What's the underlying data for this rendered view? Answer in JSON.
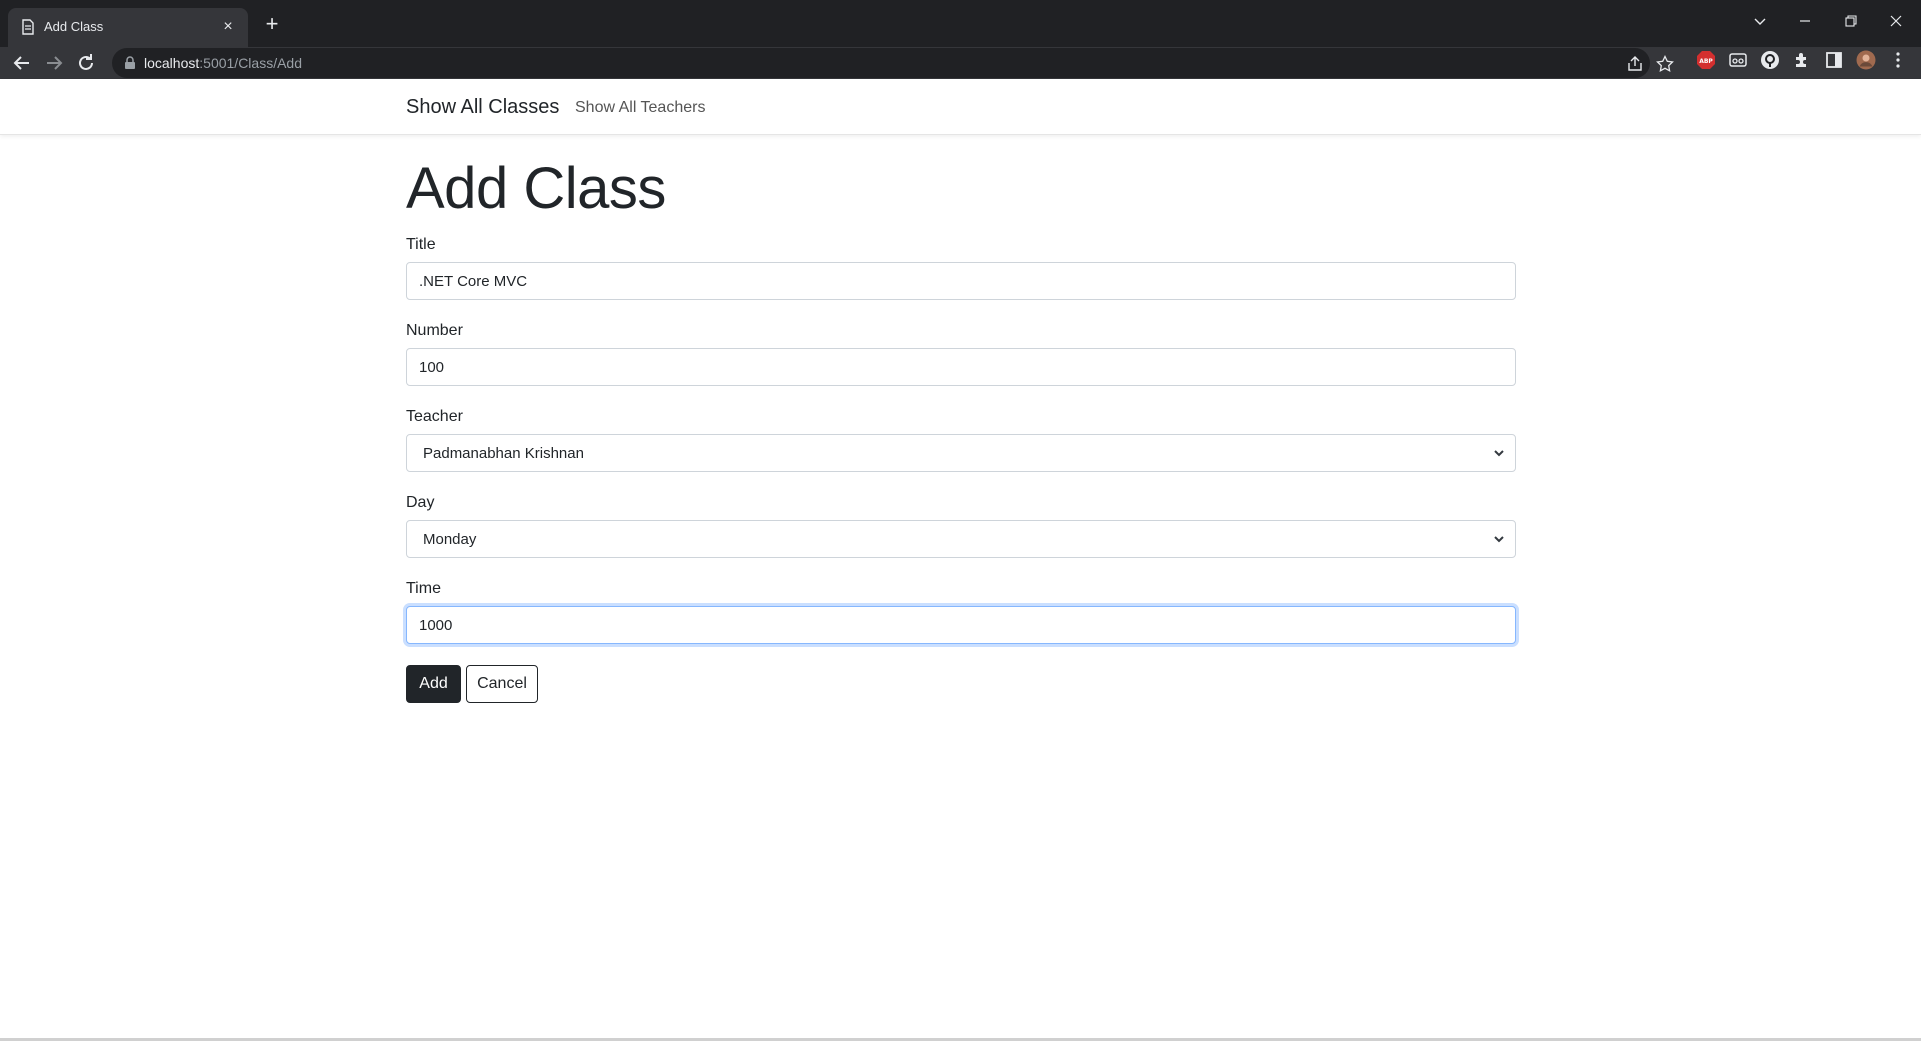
{
  "browser": {
    "tab_title": "Add Class",
    "url_host": "localhost",
    "url_path": ":5001/Class/Add",
    "new_tab_symbol": "+",
    "close_symbol": "×"
  },
  "nav": {
    "brand": "Show All Classes",
    "link": "Show All Teachers"
  },
  "form": {
    "heading": "Add Class",
    "title_label": "Title",
    "title_value": ".NET Core MVC",
    "number_label": "Number",
    "number_value": "100",
    "teacher_label": "Teacher",
    "teacher_value": "Padmanabhan Krishnan",
    "day_label": "Day",
    "day_value": "Monday",
    "time_label": "Time",
    "time_value": "1000",
    "add_button": "Add",
    "cancel_button": "Cancel"
  },
  "colors": {
    "chrome_dark": "#202124",
    "chrome_mid": "#35363a",
    "button_dark": "#212529",
    "focus_border": "#86b7fe"
  }
}
